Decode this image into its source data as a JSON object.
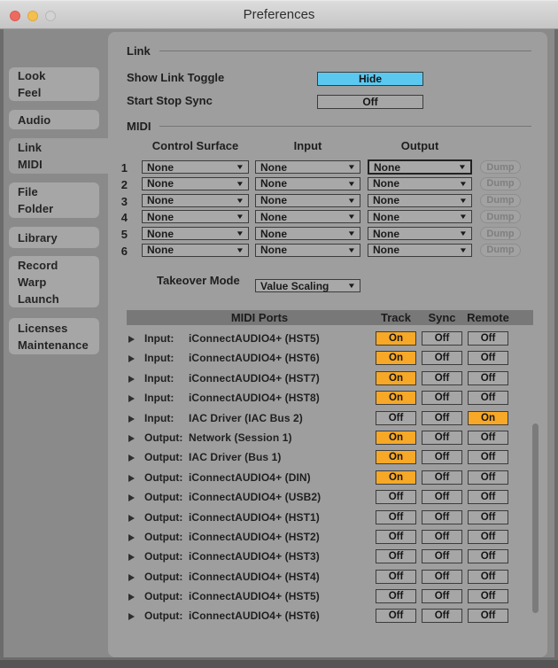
{
  "window": {
    "title": "Preferences"
  },
  "sidebar": {
    "items": [
      {
        "id": "look-feel",
        "lines": [
          "Look",
          "Feel"
        ],
        "selected": false
      },
      {
        "id": "audio",
        "lines": [
          "Audio"
        ],
        "selected": false
      },
      {
        "id": "link-midi",
        "lines": [
          "Link",
          "MIDI"
        ],
        "selected": true
      },
      {
        "id": "file-folder",
        "lines": [
          "File",
          "Folder"
        ],
        "selected": false
      },
      {
        "id": "library",
        "lines": [
          "Library"
        ],
        "selected": false
      },
      {
        "id": "record-warp-launch",
        "lines": [
          "Record",
          "Warp",
          "Launch"
        ],
        "selected": false
      },
      {
        "id": "licenses-maintenance",
        "lines": [
          "Licenses",
          "Maintenance"
        ],
        "selected": false
      }
    ]
  },
  "link_section": {
    "heading": "Link",
    "rows": [
      {
        "label": "Show Link Toggle",
        "value": "Hide",
        "style": "cyan"
      },
      {
        "label": "Start Stop Sync",
        "value": "Off",
        "style": "gray"
      }
    ]
  },
  "midi_section": {
    "heading": "MIDI",
    "columns": {
      "control_surface": "Control Surface",
      "input": "Input",
      "output": "Output"
    },
    "dump_label": "Dump",
    "surface_rows": [
      {
        "index": "1",
        "control_surface": "None",
        "input": "None",
        "output": "None",
        "output_focused": true
      },
      {
        "index": "2",
        "control_surface": "None",
        "input": "None",
        "output": "None",
        "output_focused": false
      },
      {
        "index": "3",
        "control_surface": "None",
        "input": "None",
        "output": "None",
        "output_focused": false
      },
      {
        "index": "4",
        "control_surface": "None",
        "input": "None",
        "output": "None",
        "output_focused": false
      },
      {
        "index": "5",
        "control_surface": "None",
        "input": "None",
        "output": "None",
        "output_focused": false
      },
      {
        "index": "6",
        "control_surface": "None",
        "input": "None",
        "output": "None",
        "output_focused": false
      }
    ],
    "takeover": {
      "label": "Takeover Mode",
      "value": "Value Scaling"
    }
  },
  "ports": {
    "header": {
      "title": "MIDI Ports",
      "track": "Track",
      "sync": "Sync",
      "remote": "Remote"
    },
    "rows": [
      {
        "type": "Input:",
        "name": "iConnectAUDIO4+ (HST5)",
        "track": "On",
        "sync": "Off",
        "remote": "Off"
      },
      {
        "type": "Input:",
        "name": "iConnectAUDIO4+ (HST6)",
        "track": "On",
        "sync": "Off",
        "remote": "Off"
      },
      {
        "type": "Input:",
        "name": "iConnectAUDIO4+ (HST7)",
        "track": "On",
        "sync": "Off",
        "remote": "Off"
      },
      {
        "type": "Input:",
        "name": "iConnectAUDIO4+ (HST8)",
        "track": "On",
        "sync": "Off",
        "remote": "Off"
      },
      {
        "type": "Input:",
        "name": "IAC Driver (IAC Bus 2)",
        "track": "Off",
        "sync": "Off",
        "remote": "On"
      },
      {
        "type": "Output:",
        "name": "Network (Session 1)",
        "track": "On",
        "sync": "Off",
        "remote": "Off"
      },
      {
        "type": "Output:",
        "name": "IAC Driver (Bus 1)",
        "track": "On",
        "sync": "Off",
        "remote": "Off"
      },
      {
        "type": "Output:",
        "name": "iConnectAUDIO4+ (DIN)",
        "track": "On",
        "sync": "Off",
        "remote": "Off"
      },
      {
        "type": "Output:",
        "name": "iConnectAUDIO4+ (USB2)",
        "track": "Off",
        "sync": "Off",
        "remote": "Off"
      },
      {
        "type": "Output:",
        "name": "iConnectAUDIO4+ (HST1)",
        "track": "Off",
        "sync": "Off",
        "remote": "Off"
      },
      {
        "type": "Output:",
        "name": "iConnectAUDIO4+ (HST2)",
        "track": "Off",
        "sync": "Off",
        "remote": "Off"
      },
      {
        "type": "Output:",
        "name": "iConnectAUDIO4+ (HST3)",
        "track": "Off",
        "sync": "Off",
        "remote": "Off"
      },
      {
        "type": "Output:",
        "name": "iConnectAUDIO4+ (HST4)",
        "track": "Off",
        "sync": "Off",
        "remote": "Off"
      },
      {
        "type": "Output:",
        "name": "iConnectAUDIO4+ (HST5)",
        "track": "Off",
        "sync": "Off",
        "remote": "Off"
      },
      {
        "type": "Output:",
        "name": "iConnectAUDIO4+ (HST6)",
        "track": "Off",
        "sync": "Off",
        "remote": "Off"
      }
    ]
  },
  "colors": {
    "accent_orange": "#f7a827",
    "accent_cyan": "#5bc8f0",
    "panel_gray": "#9e9e9e"
  }
}
